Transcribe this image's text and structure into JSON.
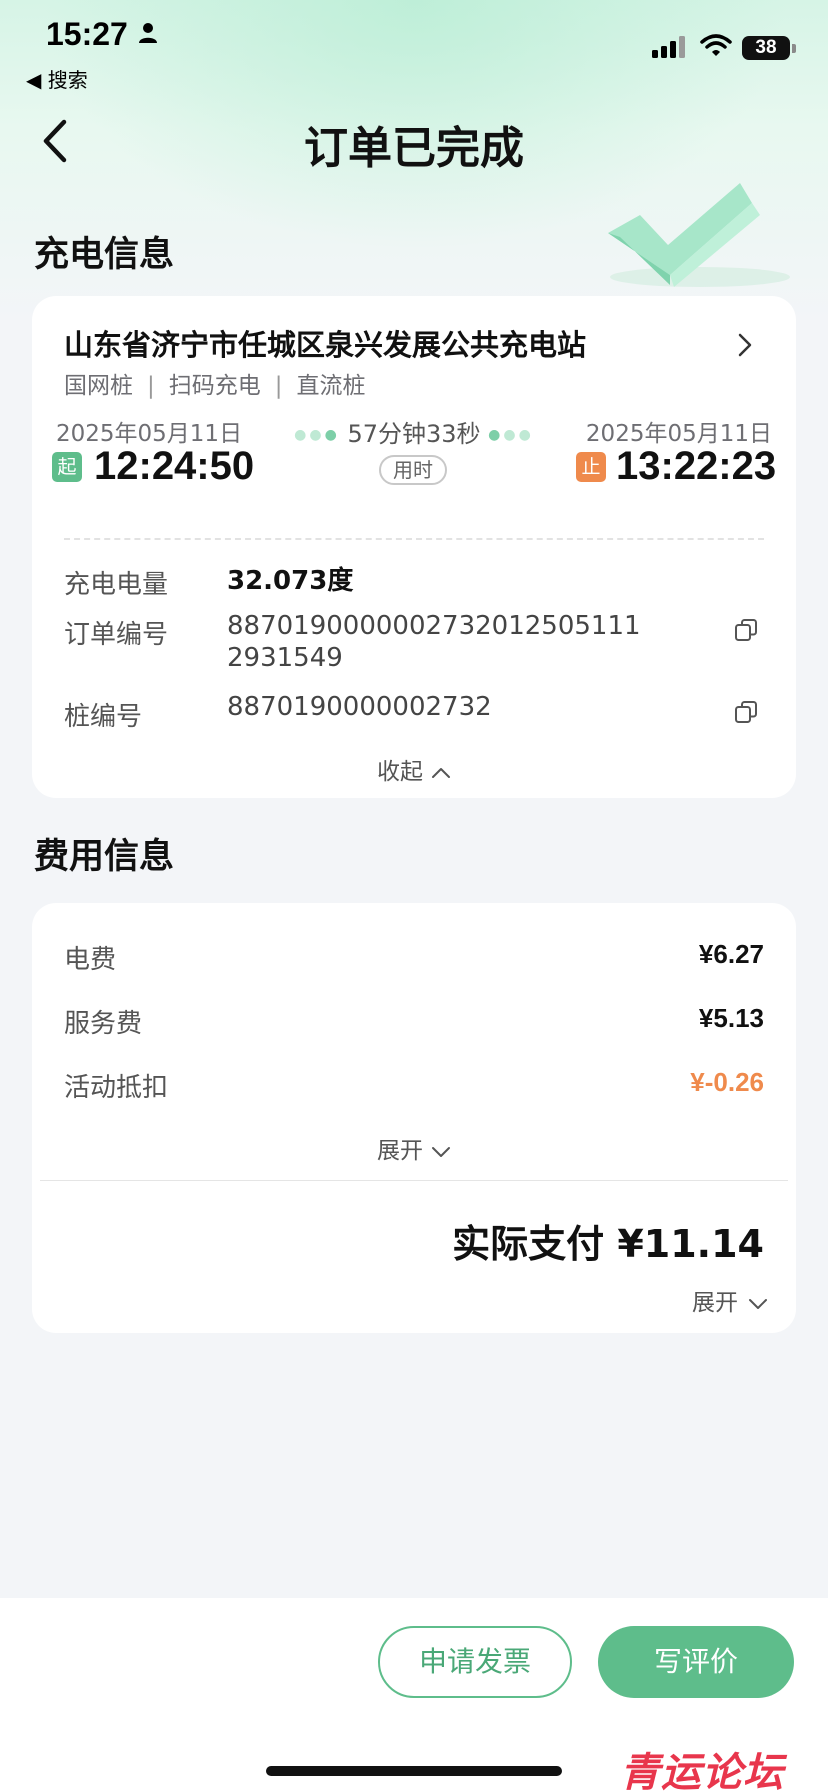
{
  "status_bar": {
    "time": "15:27",
    "back_app": "◀ 搜索",
    "battery": "38"
  },
  "header": {
    "title": "订单已完成"
  },
  "charging": {
    "section_title": "充电信息",
    "station_name": "山东省济宁市任城区泉兴发展公共充电站",
    "tags": [
      "国网桩",
      "扫码充电",
      "直流桩"
    ],
    "start_date": "2025年05月11日",
    "start_time": "12:24:50",
    "start_badge": "起",
    "end_date": "2025年05月11日",
    "end_time": "13:22:23",
    "end_badge": "止",
    "duration": "57分钟33秒",
    "duration_label": "用时",
    "rows": {
      "energy_label": "充电电量",
      "energy_value": "32.073度",
      "order_label": "订单编号",
      "order_value": "88701900000027320125051112931549",
      "pile_label": "桩编号",
      "pile_value": "8870190000002732"
    },
    "collapse_label": "收起"
  },
  "fees": {
    "section_title": "费用信息",
    "items": [
      {
        "label": "电费",
        "value": "¥6.27"
      },
      {
        "label": "服务费",
        "value": "¥5.13"
      },
      {
        "label": "活动抵扣",
        "value": "¥-0.26"
      }
    ],
    "expand_label": "展开",
    "total": "实际支付 ¥11.14",
    "total_expand_label": "展开"
  },
  "actions": {
    "invoice": "申请发票",
    "review": "写评价"
  },
  "watermark": "青运论坛",
  "colors": {
    "accent_green": "#5ebd8b",
    "accent_orange": "#ef8a4c"
  }
}
